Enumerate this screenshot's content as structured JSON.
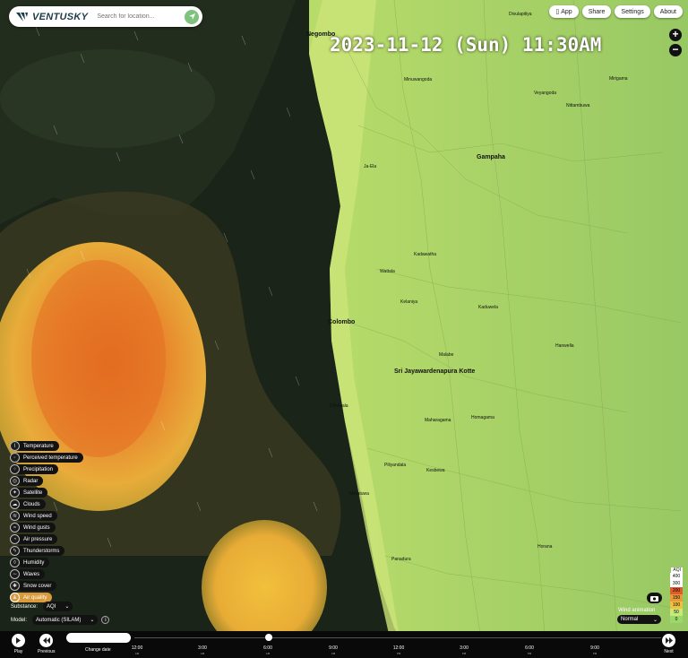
{
  "app": {
    "logo_text": "VENTUSKY"
  },
  "search": {
    "placeholder": "Search for location..."
  },
  "top_buttons": [
    "App",
    "Share",
    "Settings",
    "About"
  ],
  "datetime": "2023-11-12 (Sun) 11:30AM",
  "layers": [
    {
      "label": "Temperature",
      "icon": "thermometer-icon"
    },
    {
      "label": "Perceived temperature",
      "icon": "perceived-temp-icon"
    },
    {
      "label": "Precipitation",
      "icon": "rain-icon"
    },
    {
      "label": "Radar",
      "icon": "radar-icon"
    },
    {
      "label": "Satellite",
      "icon": "satellite-icon"
    },
    {
      "label": "Clouds",
      "icon": "cloud-icon"
    },
    {
      "label": "Wind speed",
      "icon": "wind-icon"
    },
    {
      "label": "Wind gusts",
      "icon": "gust-icon"
    },
    {
      "label": "Air pressure",
      "icon": "pressure-icon"
    },
    {
      "label": "Thunderstorms",
      "icon": "storm-icon"
    },
    {
      "label": "Humidity",
      "icon": "humidity-icon"
    },
    {
      "label": "Waves",
      "icon": "wave-icon"
    },
    {
      "label": "Snow cover",
      "icon": "snow-icon"
    },
    {
      "label": "Air quality",
      "icon": "air-quality-icon",
      "active": true
    }
  ],
  "substance": {
    "label": "Substance:",
    "value": "AQI"
  },
  "model": {
    "label": "Model:",
    "value": "Automatic (SILAM)"
  },
  "timeline": {
    "play": "Play",
    "previous": "Previous",
    "change_date": "Change date",
    "next": "Next",
    "ticks": [
      {
        "time": "12:00",
        "ampm": "AM"
      },
      {
        "time": "3:00",
        "ampm": "AM"
      },
      {
        "time": "6:00",
        "ampm": "AM"
      },
      {
        "time": "9:00",
        "ampm": "AM"
      },
      {
        "time": "12:00",
        "ampm": "PM"
      },
      {
        "time": "3:00",
        "ampm": "PM"
      },
      {
        "time": "6:00",
        "ampm": "PM"
      },
      {
        "time": "9:00",
        "ampm": "PM"
      }
    ]
  },
  "legend": {
    "unit": "AQI",
    "levels": [
      {
        "value": "400",
        "color": "#ffffff"
      },
      {
        "value": "300",
        "color": "#ffffff"
      },
      {
        "value": "200",
        "color": "#e05a2a"
      },
      {
        "value": "150",
        "color": "#e89a3a"
      },
      {
        "value": "100",
        "color": "#f0c040"
      },
      {
        "value": "50",
        "color": "#c8e878"
      },
      {
        "value": "0",
        "color": "#9ad86a"
      }
    ]
  },
  "wind_animation": {
    "label": "Wind animation",
    "value": "Normal"
  },
  "places": {
    "negombo": "Negombo",
    "colombo": "Colombo",
    "sri_jaya": "Sri Jayawardenapura Kotte",
    "gampaha": "Gampaha",
    "kelaniya": "Kelaniya",
    "dehiwala": "Dehiwala",
    "moratuwa": "Moratuwa",
    "panadura": "Panadura",
    "homagama": "Homagama",
    "kaduwela": "Kaduwela",
    "ja_ela": "Ja-Ela",
    "wattala": "Wattala",
    "kadawatha": "Kadawatha",
    "malabe": "Malabe",
    "piliyandala": "Piliyandala",
    "kesbewa": "Kesbewa",
    "maharagama": "Maharagama",
    "minuwangoda": "Minuwangoda",
    "veyangoda": "Veyangoda",
    "divulapitiya": "Divulapitiya",
    "mirigama": "Mirigama",
    "nittambuwa": "Nittambuwa",
    "hanwella": "Hanwella",
    "horana": "Horana"
  },
  "colors": {
    "land": "#a8d468",
    "sea": "#1b2418",
    "aqi_orange": "#e8862a",
    "aqi_yellow": "#f0c040"
  }
}
